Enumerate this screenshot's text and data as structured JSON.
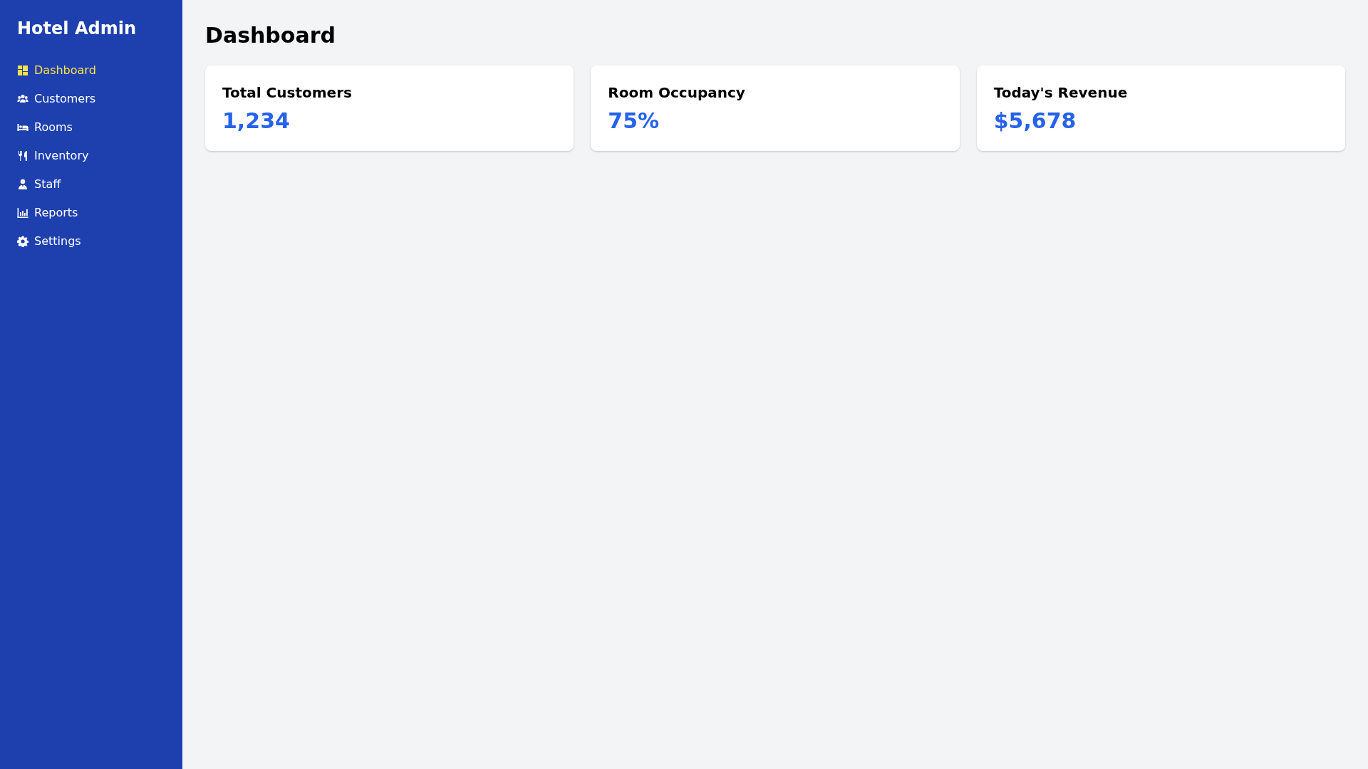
{
  "sidebar": {
    "title": "Hotel Admin",
    "items": [
      {
        "label": "Dashboard",
        "selected": true
      },
      {
        "label": "Customers",
        "selected": false
      },
      {
        "label": "Rooms",
        "selected": false
      },
      {
        "label": "Inventory",
        "selected": false
      },
      {
        "label": "Staff",
        "selected": false
      },
      {
        "label": "Reports",
        "selected": false
      },
      {
        "label": "Settings",
        "selected": false
      }
    ]
  },
  "main": {
    "title": "Dashboard",
    "cards": [
      {
        "label": "Total Customers",
        "value": "1,234"
      },
      {
        "label": "Room Occupancy",
        "value": "75%"
      },
      {
        "label": "Today's Revenue",
        "value": "$5,678"
      }
    ]
  }
}
